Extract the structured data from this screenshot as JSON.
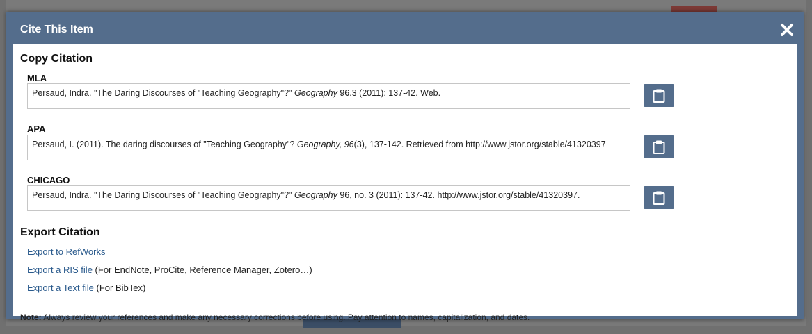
{
  "modal": {
    "title": "Cite This Item",
    "copy_section_title": "Copy Citation",
    "export_section_title": "Export Citation"
  },
  "citations": [
    {
      "style": "MLA",
      "text_before": "Persaud, Indra. \"The Daring Discourses of \"Teaching Geography\"?\" ",
      "text_italic": "Geography",
      "text_after": " 96.3 (2011): 137-42. Web."
    },
    {
      "style": "APA",
      "text_before": "Persaud, I. (2011). The daring discourses of \"Teaching Geography\"? ",
      "text_italic": "Geography, 96",
      "text_after": "(3), 137-142. Retrieved from http://www.jstor.org/stable/41320397"
    },
    {
      "style": "CHICAGO",
      "text_before": "Persaud, Indra. \"The Daring Discourses of \"Teaching Geography\"?\" ",
      "text_italic": "Geography",
      "text_after": " 96, no. 3 (2011): 137-42. http://www.jstor.org/stable/41320397."
    }
  ],
  "exports": [
    {
      "link": "Export to RefWorks",
      "suffix": ""
    },
    {
      "link": "Export a RIS file",
      "suffix": " (For EndNote, ProCite, Reference Manager, Zotero…)"
    },
    {
      "link": "Export a Text file",
      "suffix": " (For BibTex)"
    }
  ],
  "note": {
    "label": "Note:",
    "text": " Always review your references and make any necessary corrections before using. Pay attention to names, capitalization, and dates."
  },
  "icons": {
    "close": "close-icon",
    "copy": "clipboard-icon"
  },
  "colors": {
    "header": "#546d8c",
    "link": "#2a5a8c"
  }
}
